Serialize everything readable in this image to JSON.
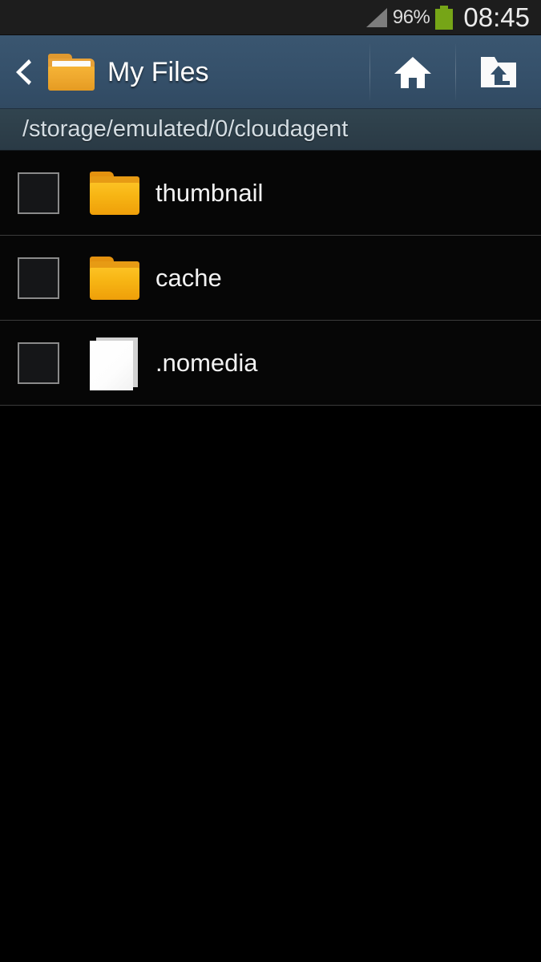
{
  "statusbar": {
    "signal_icon": "signal-triangle-icon",
    "battery_percent": "96%",
    "battery_icon": "battery-full-icon",
    "clock": "08:45",
    "battery_color": "#76a517",
    "text_color": "#dcdcdc"
  },
  "titlebar": {
    "back_icon": "back-chevron-icon",
    "app_icon": "open-folder-icon",
    "title": "My Files",
    "home_icon": "home-icon",
    "parent_icon": "folder-up-icon",
    "background_color": "#35506a"
  },
  "pathbar": {
    "path": "/storage/emulated/0/cloudagent",
    "background_color": "#2e4049",
    "text_color": "#d4dde3"
  },
  "filelist": {
    "items": [
      {
        "name": "thumbnail",
        "type": "folder",
        "icon": "folder-icon",
        "checked": false
      },
      {
        "name": "cache",
        "type": "folder",
        "icon": "folder-icon",
        "checked": false
      },
      {
        "name": ".nomedia",
        "type": "file",
        "icon": "file-icon",
        "checked": false
      }
    ],
    "folder_color": "#f7b514",
    "divider_color": "#3a3a3a",
    "background_color": "#000000"
  }
}
